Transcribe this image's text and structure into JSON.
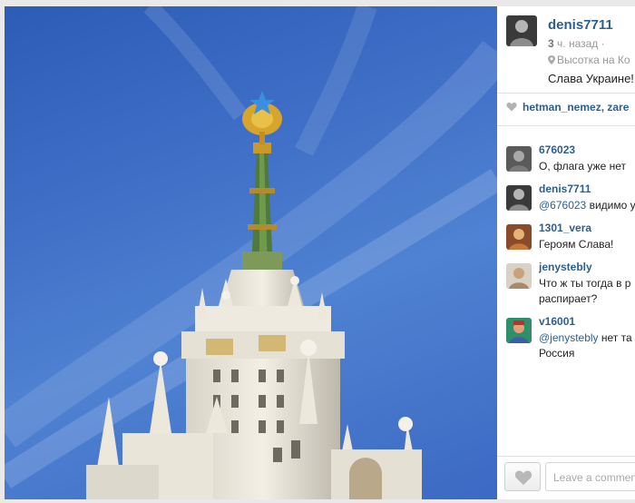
{
  "post": {
    "author": "denis7711",
    "time_value": "3",
    "time_unit": "ч. назад",
    "time_sep": "·",
    "location": "Высотка на Ко",
    "caption": "Слава Украине!"
  },
  "likes": {
    "users": "hetman_nemez, zare"
  },
  "comments": [
    {
      "user": "676023",
      "text": "О, флага уже нет",
      "text2": ""
    },
    {
      "user": "denis7711",
      "mention": "@676023",
      "text": " видимо у",
      "text2": ""
    },
    {
      "user": "1301_vera",
      "text": "Героям Слава!",
      "text2": ""
    },
    {
      "user": "jenystebly",
      "text": "Что ж ты тогда в р",
      "text2": "распирает?"
    },
    {
      "user": "v16001",
      "mention": "@jenystebly",
      "text": " нет та",
      "text2": "Россия"
    }
  ],
  "input": {
    "placeholder": "Leave a commen"
  },
  "colors": {
    "username": "#2d5f8c",
    "sky": "#3d6dc5",
    "star": "#3a8fe0"
  },
  "icons": {
    "location": "map-pin-icon",
    "like": "heart-icon"
  }
}
